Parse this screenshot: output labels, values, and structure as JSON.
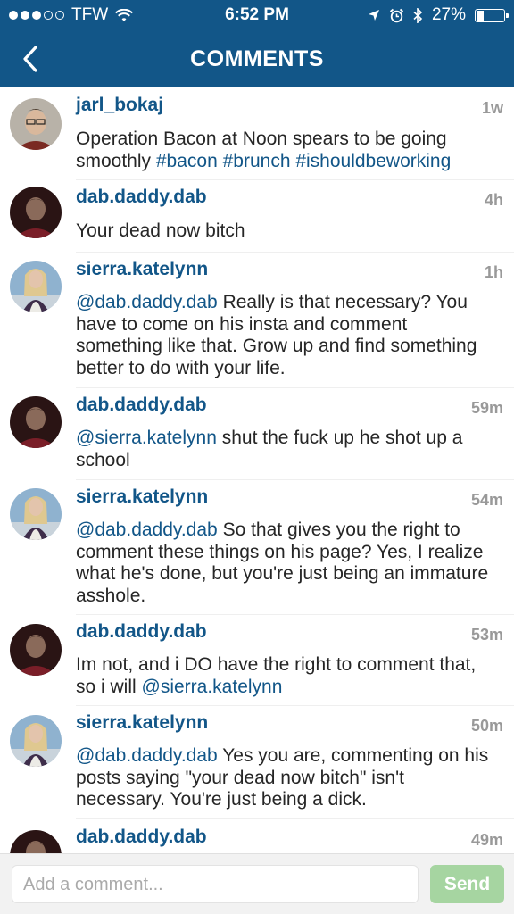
{
  "status_bar": {
    "carrier": "TFW",
    "time": "6:52 PM",
    "battery": "27%",
    "battery_level": 0.27
  },
  "nav": {
    "title": "COMMENTS"
  },
  "comments": [
    {
      "user": "jarl_bokaj",
      "time": "1w",
      "parts": [
        "Operation Bacon at Noon spears to be going smoothly ",
        "#bacon #brunch #ishouldbeworking"
      ]
    },
    {
      "user": "dab.daddy.dab",
      "time": "4h",
      "parts": [
        "Your dead now bitch"
      ]
    },
    {
      "user": "sierra.katelynn",
      "time": "1h",
      "parts": [
        "@dab.daddy.dab",
        " Really is that necessary? You have to come on his insta and comment something like that. Grow up and find something better to do with your life."
      ]
    },
    {
      "user": "dab.daddy.dab",
      "time": "59m",
      "parts": [
        "@sierra.katelynn",
        " shut the fuck up he shot up a school"
      ]
    },
    {
      "user": "sierra.katelynn",
      "time": "54m",
      "parts": [
        "@dab.daddy.dab",
        " So that gives you the right to comment these things on his page? Yes, I realize what he's done, but you're just being an immature asshole."
      ]
    },
    {
      "user": "dab.daddy.dab",
      "time": "53m",
      "parts": [
        "Im not, and i DO have the right to comment that, so i will ",
        "@sierra.katelynn"
      ]
    },
    {
      "user": "sierra.katelynn",
      "time": "50m",
      "parts": [
        "@dab.daddy.dab",
        " Yes you are, commenting on his posts saying \"your dead now bitch\" isn't necessary. You're just being a dick."
      ]
    },
    {
      "user": "dab.daddy.dab",
      "time": "49m",
      "parts": []
    }
  ],
  "input": {
    "placeholder": "Add a comment..."
  },
  "send_label": "Send"
}
